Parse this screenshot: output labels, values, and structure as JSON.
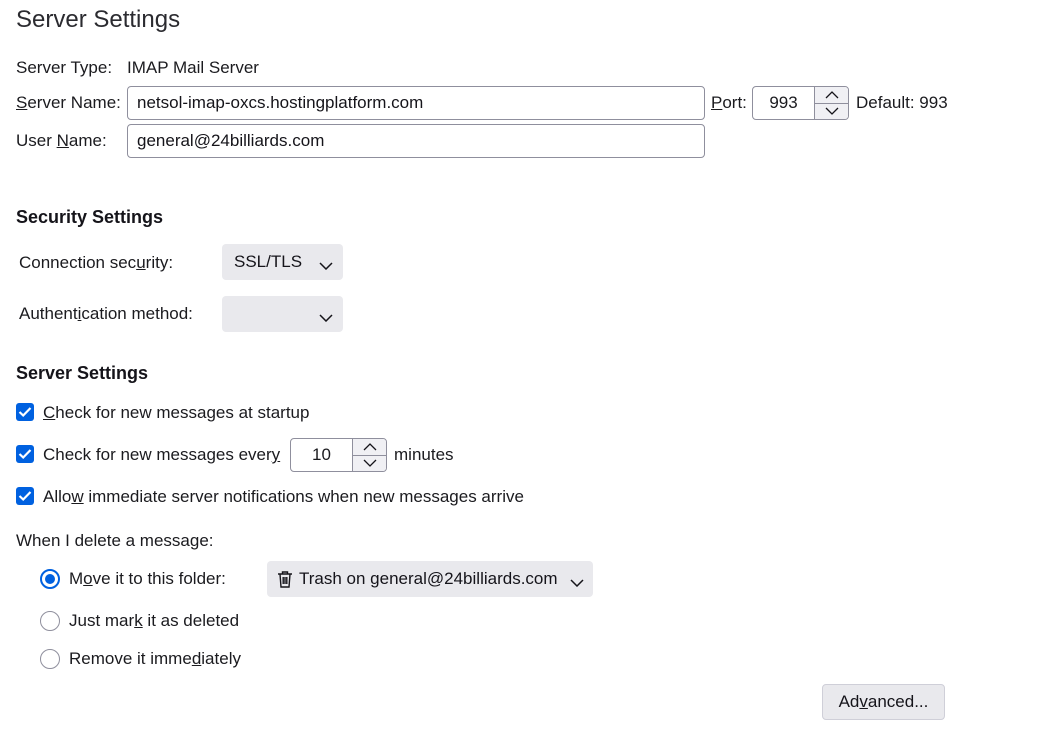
{
  "page": {
    "title": "Server Settings"
  },
  "server": {
    "type_label": "Server Type:",
    "type_value": "IMAP Mail Server",
    "name_label_u": "S",
    "name_label_rest": "erver Name:",
    "name_value": "netsol-imap-oxcs.hostingplatform.com",
    "port_label_u": "P",
    "port_label_rest": "ort:",
    "port_value": "993",
    "default_label": "Default: 993",
    "user_label_pre": "User ",
    "user_label_u": "N",
    "user_label_rest": "ame:",
    "user_value": "general@24billiards.com"
  },
  "security": {
    "heading": "Security Settings",
    "conn_label_pre": "Connection sec",
    "conn_label_u": "u",
    "conn_label_rest": "rity:",
    "conn_value": "SSL/TLS",
    "auth_label_pre": "Authent",
    "auth_label_u": "i",
    "auth_label_rest": "cation method:",
    "auth_value": ""
  },
  "settings": {
    "heading": "Server Settings",
    "check_startup_u": "C",
    "check_startup_rest": "heck for new messages at startup",
    "check_startup_checked": true,
    "check_every_pre": "Check for new messages ever",
    "check_every_u": "y",
    "check_every_value": "10",
    "check_every_suffix": "minutes",
    "check_every_checked": true,
    "allow_pre": "Allo",
    "allow_u": "w",
    "allow_rest": " immediate server notifications when new messages arrive",
    "allow_checked": true
  },
  "delete": {
    "heading": "When I delete a message:",
    "move_pre": "M",
    "move_u": "o",
    "move_rest": "ve it to this folder:",
    "move_selected": true,
    "folder_value": "Trash on general@24billiards.com",
    "folder_icon": "trash-icon",
    "mark_pre": "Just mar",
    "mark_u": "k",
    "mark_rest": " it as deleted",
    "remove_pre": "Remove it imme",
    "remove_u": "d",
    "remove_rest": "iately"
  },
  "advanced": {
    "label_pre": "Ad",
    "label_u": "v",
    "label_rest": "anced..."
  },
  "colors": {
    "accent": "#0061e0",
    "button_bg": "#e9e9ed",
    "border": "#8f8f9d"
  }
}
